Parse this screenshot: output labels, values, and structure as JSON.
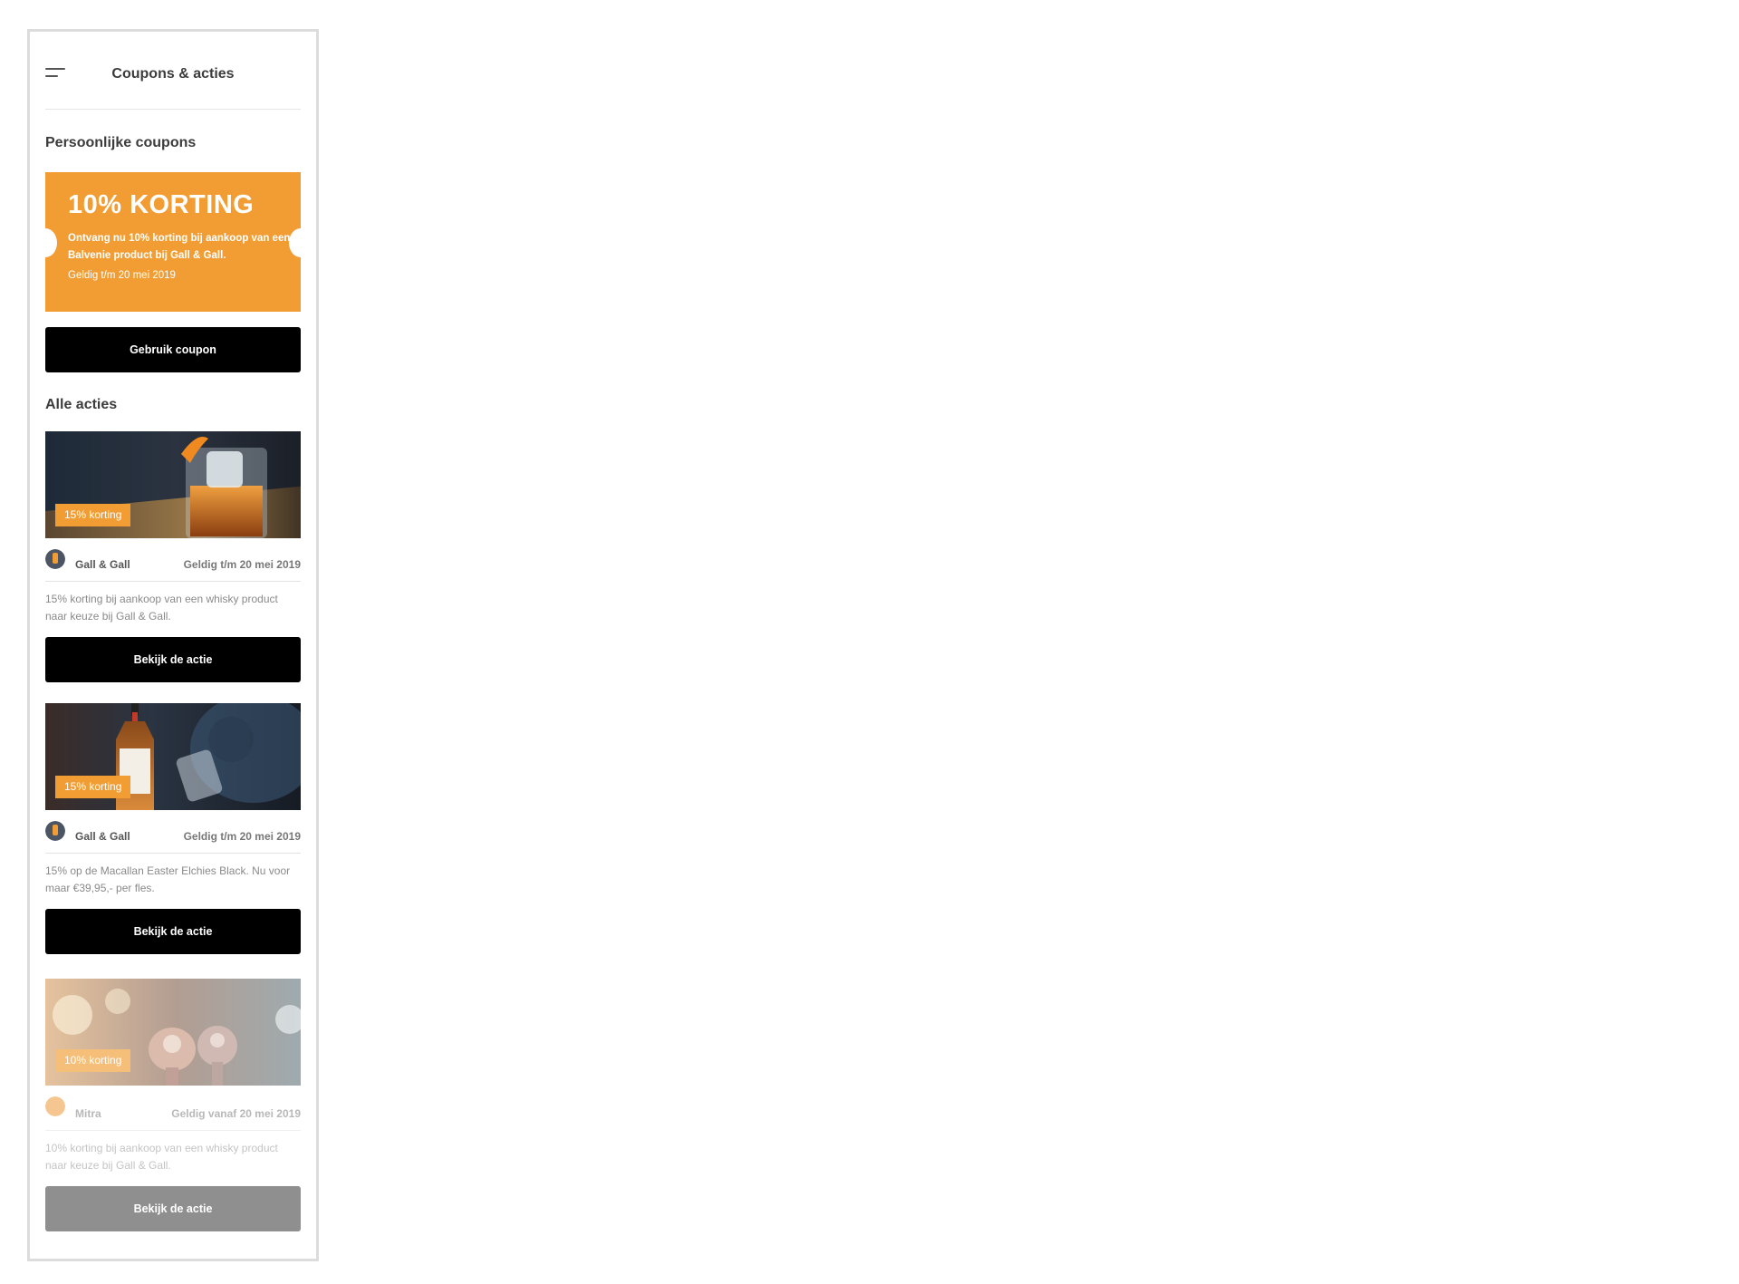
{
  "header": {
    "title": "Coupons & acties"
  },
  "personal": {
    "section_title": "Persoonlijke coupons",
    "coupon": {
      "title": "10% KORTING",
      "description": "Ontvang nu 10% korting bij aankoop van een Balvenie product bij Gall & Gall.",
      "valid": "Geldig t/m 20 mei 2019",
      "color": "#f29d33"
    },
    "button_label": "Gebruik coupon"
  },
  "actions": {
    "section_title": "Alle acties",
    "items": [
      {
        "badge": "15% korting",
        "brand": "Gall & Gall",
        "valid": "Geldig t/m 20 mei 2019",
        "description": "15% korting bij aankoop van een whisky product naar keuze bij Gall & Gall.",
        "button_label": "Bekijk de actie",
        "image": "whisky-glass-photo"
      },
      {
        "badge": "15% korting",
        "brand": "Gall & Gall",
        "valid": "Geldig t/m 20 mei 2019",
        "description": "15% op de Macallan Easter Elchies Black. Nu voor maar €39,95,- per fles.",
        "button_label": "Bekijk de actie",
        "image": "macallan-bottle-photo"
      },
      {
        "badge": "10% korting",
        "brand": "Mitra",
        "valid": "Geldig vanaf 20 mei 2019",
        "description": "10% korting bij aankoop van een whisky product naar keuze bij Gall & Gall.",
        "button_label": "Bekijk de actie",
        "image": "crystal-decanters-photo"
      }
    ]
  },
  "colors": {
    "accent": "#f29d33",
    "button": "#000000",
    "button_disabled": "#8f8f8f"
  }
}
